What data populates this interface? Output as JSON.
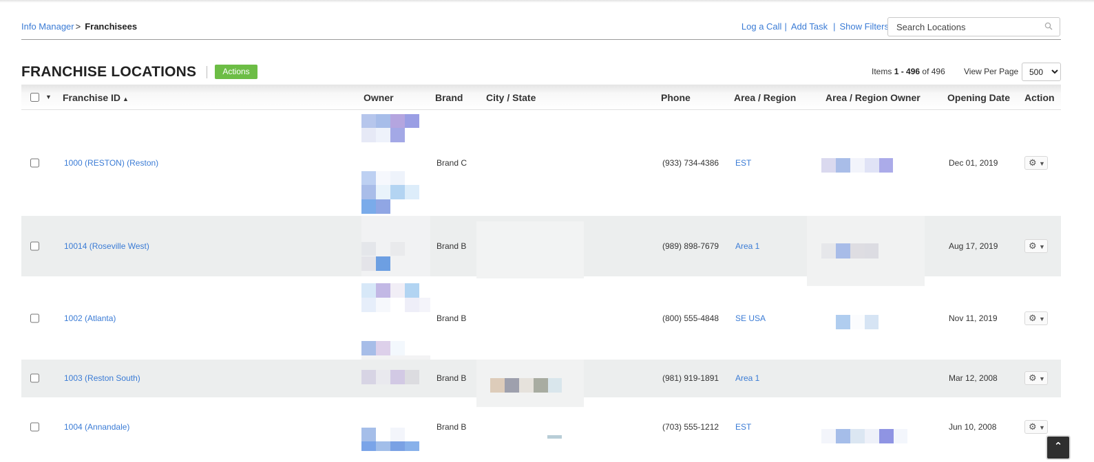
{
  "breadcrumb": {
    "parent": "Info Manager",
    "separator": ">",
    "current": "Franchisees"
  },
  "toplinks": {
    "log_call": "Log a Call",
    "add_task": "Add Task",
    "show_filters": "Show Filters",
    "pipe": "|"
  },
  "search": {
    "placeholder": "Search Locations",
    "icon": "search-icon"
  },
  "page": {
    "title": "FRANCHISE LOCATIONS",
    "actions_label": "Actions"
  },
  "pagination": {
    "items_label": "Items",
    "range": "1 - 496",
    "of_label": "of",
    "total": "496",
    "view_per_page_label": "View Per Page",
    "per_page": "500"
  },
  "table": {
    "columns": {
      "franchise_id": "Franchise ID",
      "owner": "Owner",
      "brand": "Brand",
      "city_state": "City /  State",
      "phone": "Phone",
      "area_region": "Area / Region",
      "area_region_owner": "Area / Region Owner",
      "opening_date": "Opening Date",
      "action": "Action"
    },
    "sort_indicator": "▲",
    "rows": [
      {
        "franchise_id": "1000 (RESTON) (Reston)",
        "brand": "Brand C",
        "phone": "(933) 734-4386",
        "area_region": "EST",
        "opening_date": "Dec 01, 2019"
      },
      {
        "franchise_id": "10014 (Roseville West)",
        "brand": "Brand B",
        "phone": "(989) 898-7679",
        "area_region": "Area 1",
        "opening_date": "Aug 17, 2019"
      },
      {
        "franchise_id": "1002 (Atlanta)",
        "brand": "Brand B",
        "phone": "(800) 555-4848",
        "area_region": "SE USA",
        "opening_date": "Nov 11, 2019"
      },
      {
        "franchise_id": "1003 (Reston South)",
        "brand": "Brand B",
        "phone": "(981) 919-1891",
        "area_region": "Area 1",
        "opening_date": "Mar 12, 2008"
      },
      {
        "franchise_id": "1004 (Annandale)",
        "brand": "Brand B",
        "phone": "(703) 555-1212",
        "area_region": "EST",
        "opening_date": "Jun 10, 2008"
      }
    ]
  },
  "icons": {
    "gear": "gear-icon",
    "dropdown": "caret-down-icon",
    "scroll_top": "scroll-to-top-icon"
  },
  "colors": {
    "link": "#3a7bd5",
    "actions_button": "#6cbd45",
    "row_alt": "#eceeee"
  }
}
